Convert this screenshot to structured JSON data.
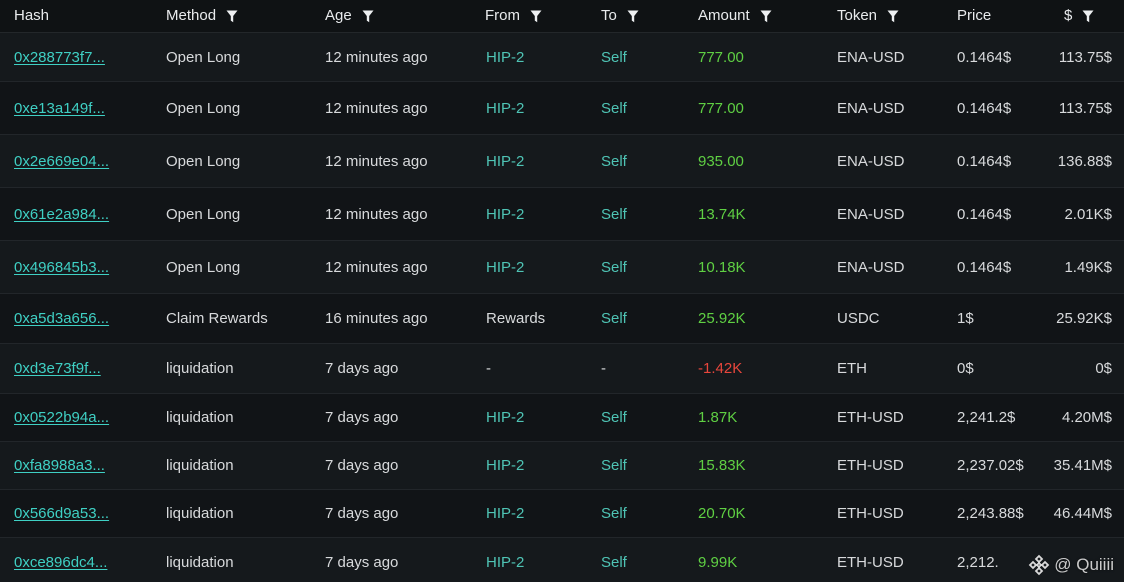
{
  "columns": [
    {
      "key": "hash",
      "label": "Hash",
      "filter": false
    },
    {
      "key": "method",
      "label": "Method",
      "filter": true
    },
    {
      "key": "age",
      "label": "Age",
      "filter": true
    },
    {
      "key": "from",
      "label": "From",
      "filter": true
    },
    {
      "key": "to",
      "label": "To",
      "filter": true
    },
    {
      "key": "amount",
      "label": "Amount",
      "filter": true
    },
    {
      "key": "token",
      "label": "Token",
      "filter": true
    },
    {
      "key": "price",
      "label": "Price",
      "filter": false
    },
    {
      "key": "usd",
      "label": "$",
      "filter": true
    }
  ],
  "colors": {
    "link": "#3fd0c4",
    "teal": "#4fc4b5",
    "positive": "#5fd043",
    "negative": "#e8463c",
    "text": "#d8dadc"
  },
  "rows": [
    {
      "hash": "0x288773f7...",
      "method": "Open Long",
      "age": "12 minutes ago",
      "from": "HIP-2",
      "from_style": "teal",
      "to": "Self",
      "to_style": "teal",
      "amount": "777.00",
      "amount_style": "green",
      "token": "ENA-USD",
      "price": "0.1464$",
      "usd": "113.75$"
    },
    {
      "hash": "0xe13a149f...",
      "method": "Open Long",
      "age": "12 minutes ago",
      "from": "HIP-2",
      "from_style": "teal",
      "to": "Self",
      "to_style": "teal",
      "amount": "777.00",
      "amount_style": "green",
      "token": "ENA-USD",
      "price": "0.1464$",
      "usd": "113.75$"
    },
    {
      "hash": "0x2e669e04...",
      "method": "Open Long",
      "age": "12 minutes ago",
      "from": "HIP-2",
      "from_style": "teal",
      "to": "Self",
      "to_style": "teal",
      "amount": "935.00",
      "amount_style": "green",
      "token": "ENA-USD",
      "price": "0.1464$",
      "usd": "136.88$"
    },
    {
      "hash": "0x61e2a984...",
      "method": "Open Long",
      "age": "12 minutes ago",
      "from": "HIP-2",
      "from_style": "teal",
      "to": "Self",
      "to_style": "teal",
      "amount": "13.74K",
      "amount_style": "green",
      "token": "ENA-USD",
      "price": "0.1464$",
      "usd": "2.01K$"
    },
    {
      "hash": "0x496845b3...",
      "method": "Open Long",
      "age": "12 minutes ago",
      "from": "HIP-2",
      "from_style": "teal",
      "to": "Self",
      "to_style": "teal",
      "amount": "10.18K",
      "amount_style": "green",
      "token": "ENA-USD",
      "price": "0.1464$",
      "usd": "1.49K$"
    },
    {
      "hash": "0xa5d3a656...",
      "method": "Claim Rewards",
      "age": "16 minutes ago",
      "from": "Rewards",
      "from_style": "plain",
      "to": "Self",
      "to_style": "teal",
      "amount": "25.92K",
      "amount_style": "green",
      "token": "USDC",
      "price": "1$",
      "usd": "25.92K$"
    },
    {
      "hash": "0xd3e73f9f...",
      "method": "liquidation",
      "age": "7 days ago",
      "from": "-",
      "from_style": "plain",
      "to": "-",
      "to_style": "plain",
      "amount": "-1.42K",
      "amount_style": "red",
      "token": "ETH",
      "price": "0$",
      "usd": "0$"
    },
    {
      "hash": "0x0522b94a...",
      "method": "liquidation",
      "age": "7 days ago",
      "from": "HIP-2",
      "from_style": "teal",
      "to": "Self",
      "to_style": "teal",
      "amount": "1.87K",
      "amount_style": "green",
      "token": "ETH-USD",
      "price": "2,241.2$",
      "usd": "4.20M$"
    },
    {
      "hash": "0xfa8988a3...",
      "method": "liquidation",
      "age": "7 days ago",
      "from": "HIP-2",
      "from_style": "teal",
      "to": "Self",
      "to_style": "teal",
      "amount": "15.83K",
      "amount_style": "green",
      "token": "ETH-USD",
      "price": "2,237.02$",
      "usd": "35.41M$"
    },
    {
      "hash": "0x566d9a53...",
      "method": "liquidation",
      "age": "7 days ago",
      "from": "HIP-2",
      "from_style": "teal",
      "to": "Self",
      "to_style": "teal",
      "amount": "20.70K",
      "amount_style": "green",
      "token": "ETH-USD",
      "price": "2,243.88$",
      "usd": "46.44M$"
    },
    {
      "hash": "0xce896dc4...",
      "method": "liquidation",
      "age": "7 days ago",
      "from": "HIP-2",
      "from_style": "teal",
      "to": "Self",
      "to_style": "teal",
      "amount": "9.99K",
      "amount_style": "green",
      "token": "ETH-USD",
      "price": "2,212.",
      "usd": ""
    }
  ],
  "watermark": {
    "icon": "binance-square-logo-icon",
    "text": "@ Quiiii"
  }
}
